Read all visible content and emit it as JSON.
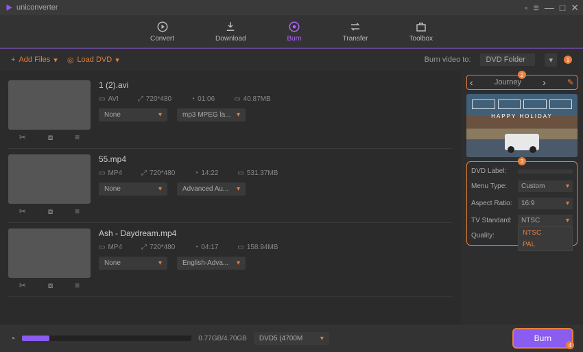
{
  "app": {
    "name": "uniconverter"
  },
  "tabs": {
    "convert": "Convert",
    "download": "Download",
    "burn": "Burn",
    "transfer": "Transfer",
    "toolbox": "Toolbox"
  },
  "toolbar": {
    "add_files": "Add Files",
    "load_dvd": "Load DVD",
    "burn_to_label": "Burn video to:",
    "burn_to_value": "DVD Folder"
  },
  "callouts": {
    "one": "1",
    "two": "2",
    "three": "3",
    "four": "4"
  },
  "items": [
    {
      "name": "1 (2).avi",
      "format": "AVI",
      "res": "720*480",
      "dur": "01:06",
      "size": "40.87MB",
      "sub": "None",
      "audio": "mp3 MPEG la..."
    },
    {
      "name": "55.mp4",
      "format": "MP4",
      "res": "720*480",
      "dur": "14:22",
      "size": "531.37MB",
      "sub": "None",
      "audio": "Advanced Au..."
    },
    {
      "name": "Ash - Daydream.mp4",
      "format": "MP4",
      "res": "720*480",
      "dur": "04:17",
      "size": "158.94MB",
      "sub": "None",
      "audio": "English-Adva..."
    }
  ],
  "template": {
    "name": "Journey",
    "preview_text": "HAPPY HOLIDAY"
  },
  "settings": {
    "dvd_label_lbl": "DVD Label:",
    "dvd_label_val": "",
    "menu_type_lbl": "Menu Type:",
    "menu_type_val": "Custom",
    "aspect_lbl": "Aspect Ratio:",
    "aspect_val": "16:9",
    "tvstd_lbl": "TV Standard:",
    "tvstd_val": "NTSC",
    "tvstd_options": [
      "NTSC",
      "PAL"
    ],
    "quality_lbl": "Quality:"
  },
  "footer": {
    "size": "0.77GB/4.70GB",
    "disc": "DVD5 (4700M",
    "burn": "Burn",
    "progress_pct": 16
  }
}
